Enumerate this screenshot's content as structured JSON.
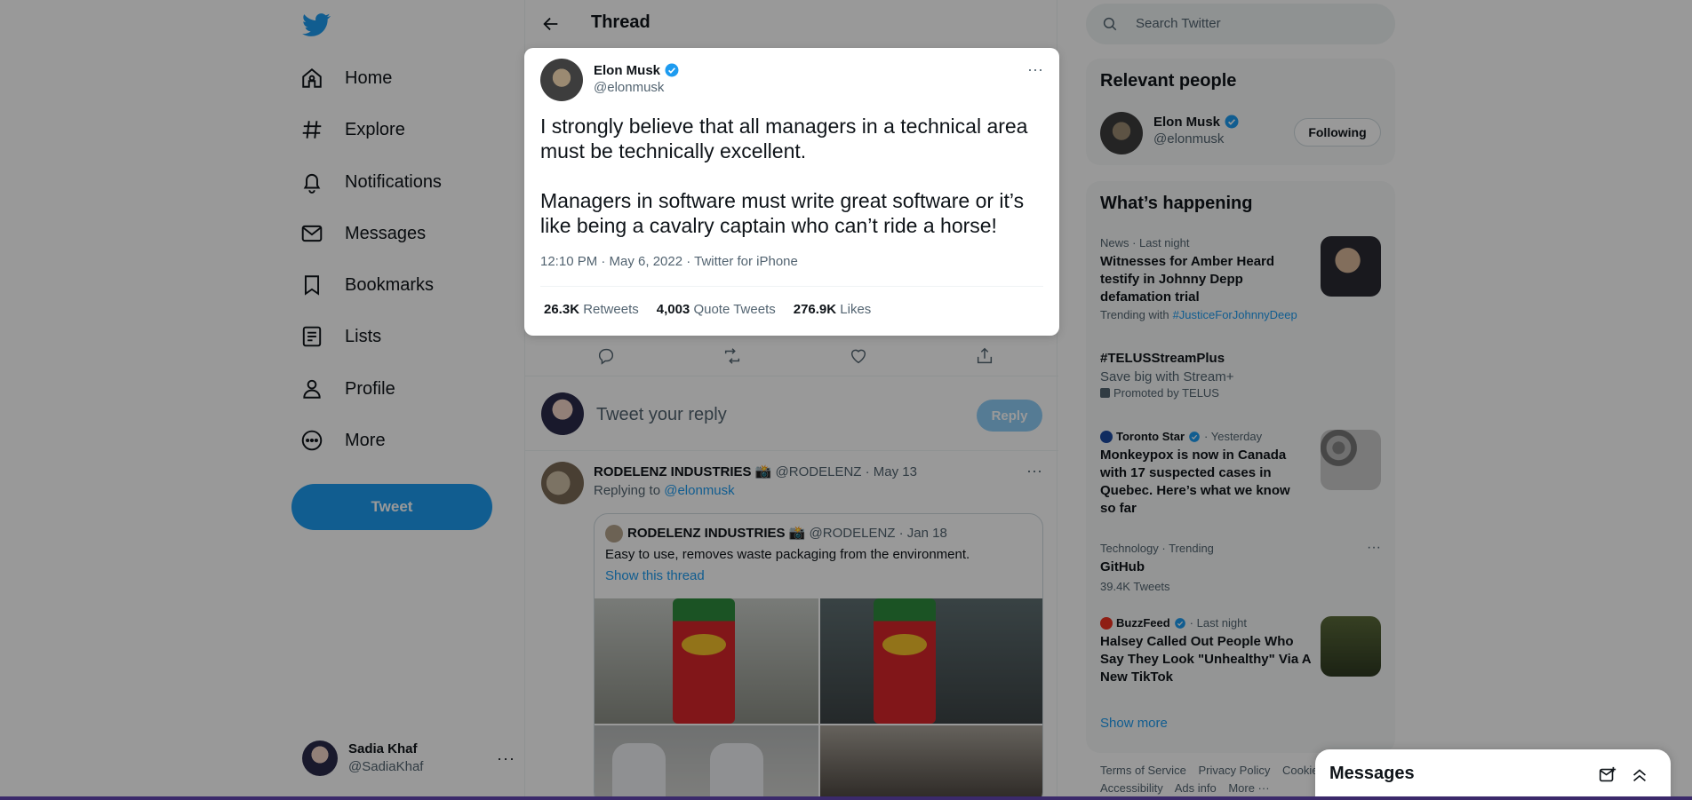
{
  "nav": {
    "items": [
      {
        "label": "Home",
        "icon": "home-icon"
      },
      {
        "label": "Explore",
        "icon": "hashtag-icon"
      },
      {
        "label": "Notifications",
        "icon": "bell-icon"
      },
      {
        "label": "Messages",
        "icon": "envelope-icon"
      },
      {
        "label": "Bookmarks",
        "icon": "bookmark-icon"
      },
      {
        "label": "Lists",
        "icon": "list-icon"
      },
      {
        "label": "Profile",
        "icon": "person-icon"
      },
      {
        "label": "More",
        "icon": "more-circle-icon"
      }
    ],
    "tweet_button": "Tweet"
  },
  "account": {
    "name": "Sadia Khaf",
    "handle": "@SadiaKhaf"
  },
  "thread": {
    "title": "Thread"
  },
  "modal_tweet": {
    "name": "Elon Musk",
    "handle": "@elonmusk",
    "para1": "I strongly believe that all managers in a technical area must be technically excellent.",
    "para2": "Managers in software must write great software or it’s like being a cavalry captain who can’t ride a horse!",
    "meta": "12:10 PM · May 6, 2022 · Twitter for iPhone",
    "retweets_count": "26.3K",
    "retweets_label": "Retweets",
    "quotes_count": "4,003",
    "quotes_label": "Quote Tweets",
    "likes_count": "276.9K",
    "likes_label": "Likes"
  },
  "compose": {
    "placeholder": "Tweet your reply",
    "button": "Reply"
  },
  "reply": {
    "name": "RODELENZ INDUSTRIES 📸",
    "handle": "@RODELENZ",
    "date": "· May 13",
    "replying_prefix": "Replying to",
    "replying_to": "@elonmusk",
    "quote": {
      "name": "RODELENZ INDUSTRIES 📸",
      "handle": "@RODELENZ",
      "date": "· Jan 18",
      "text": "Easy to use, removes waste packaging from the environment.",
      "show_thread": "Show this thread"
    }
  },
  "search": {
    "placeholder": "Search Twitter"
  },
  "relevant": {
    "title": "Relevant people",
    "name": "Elon Musk",
    "handle": "@elonmusk",
    "button": "Following"
  },
  "happening": {
    "title": "What’s happening",
    "trends": [
      {
        "meta": "News · Last night",
        "headline": "Witnesses for Amber Heard testify in Johnny Depp defamation trial",
        "trending_prefix": "Trending with",
        "trending_tag": "#JusticeForJohnnyDeep"
      },
      {
        "headline": "#TELUSStreamPlus",
        "desc": "Save big with Stream+",
        "promoted": "Promoted by TELUS"
      },
      {
        "source": "Toronto Star",
        "time": "· Yesterday",
        "headline": "Monkeypox is now in Canada with 17 suspected cases in Quebec. Here’s what we know so far"
      },
      {
        "meta": "Technology · Trending",
        "headline": "GitHub",
        "desc": "39.4K Tweets"
      },
      {
        "source": "BuzzFeed",
        "time": "· Last night",
        "headline": "Halsey Called Out People Who Say They Look \"Unhealthy\" Via A New TikTok"
      }
    ],
    "show_more": "Show more"
  },
  "footer": {
    "links": [
      "Terms of Service",
      "Privacy Policy",
      "Cookie"
    ],
    "links2": [
      "Accessibility",
      "Ads info",
      "More ···"
    ]
  },
  "messages": {
    "title": "Messages"
  },
  "colors": {
    "accent": "#1d9bf0",
    "text": "#0f1419",
    "muted": "#536471"
  }
}
